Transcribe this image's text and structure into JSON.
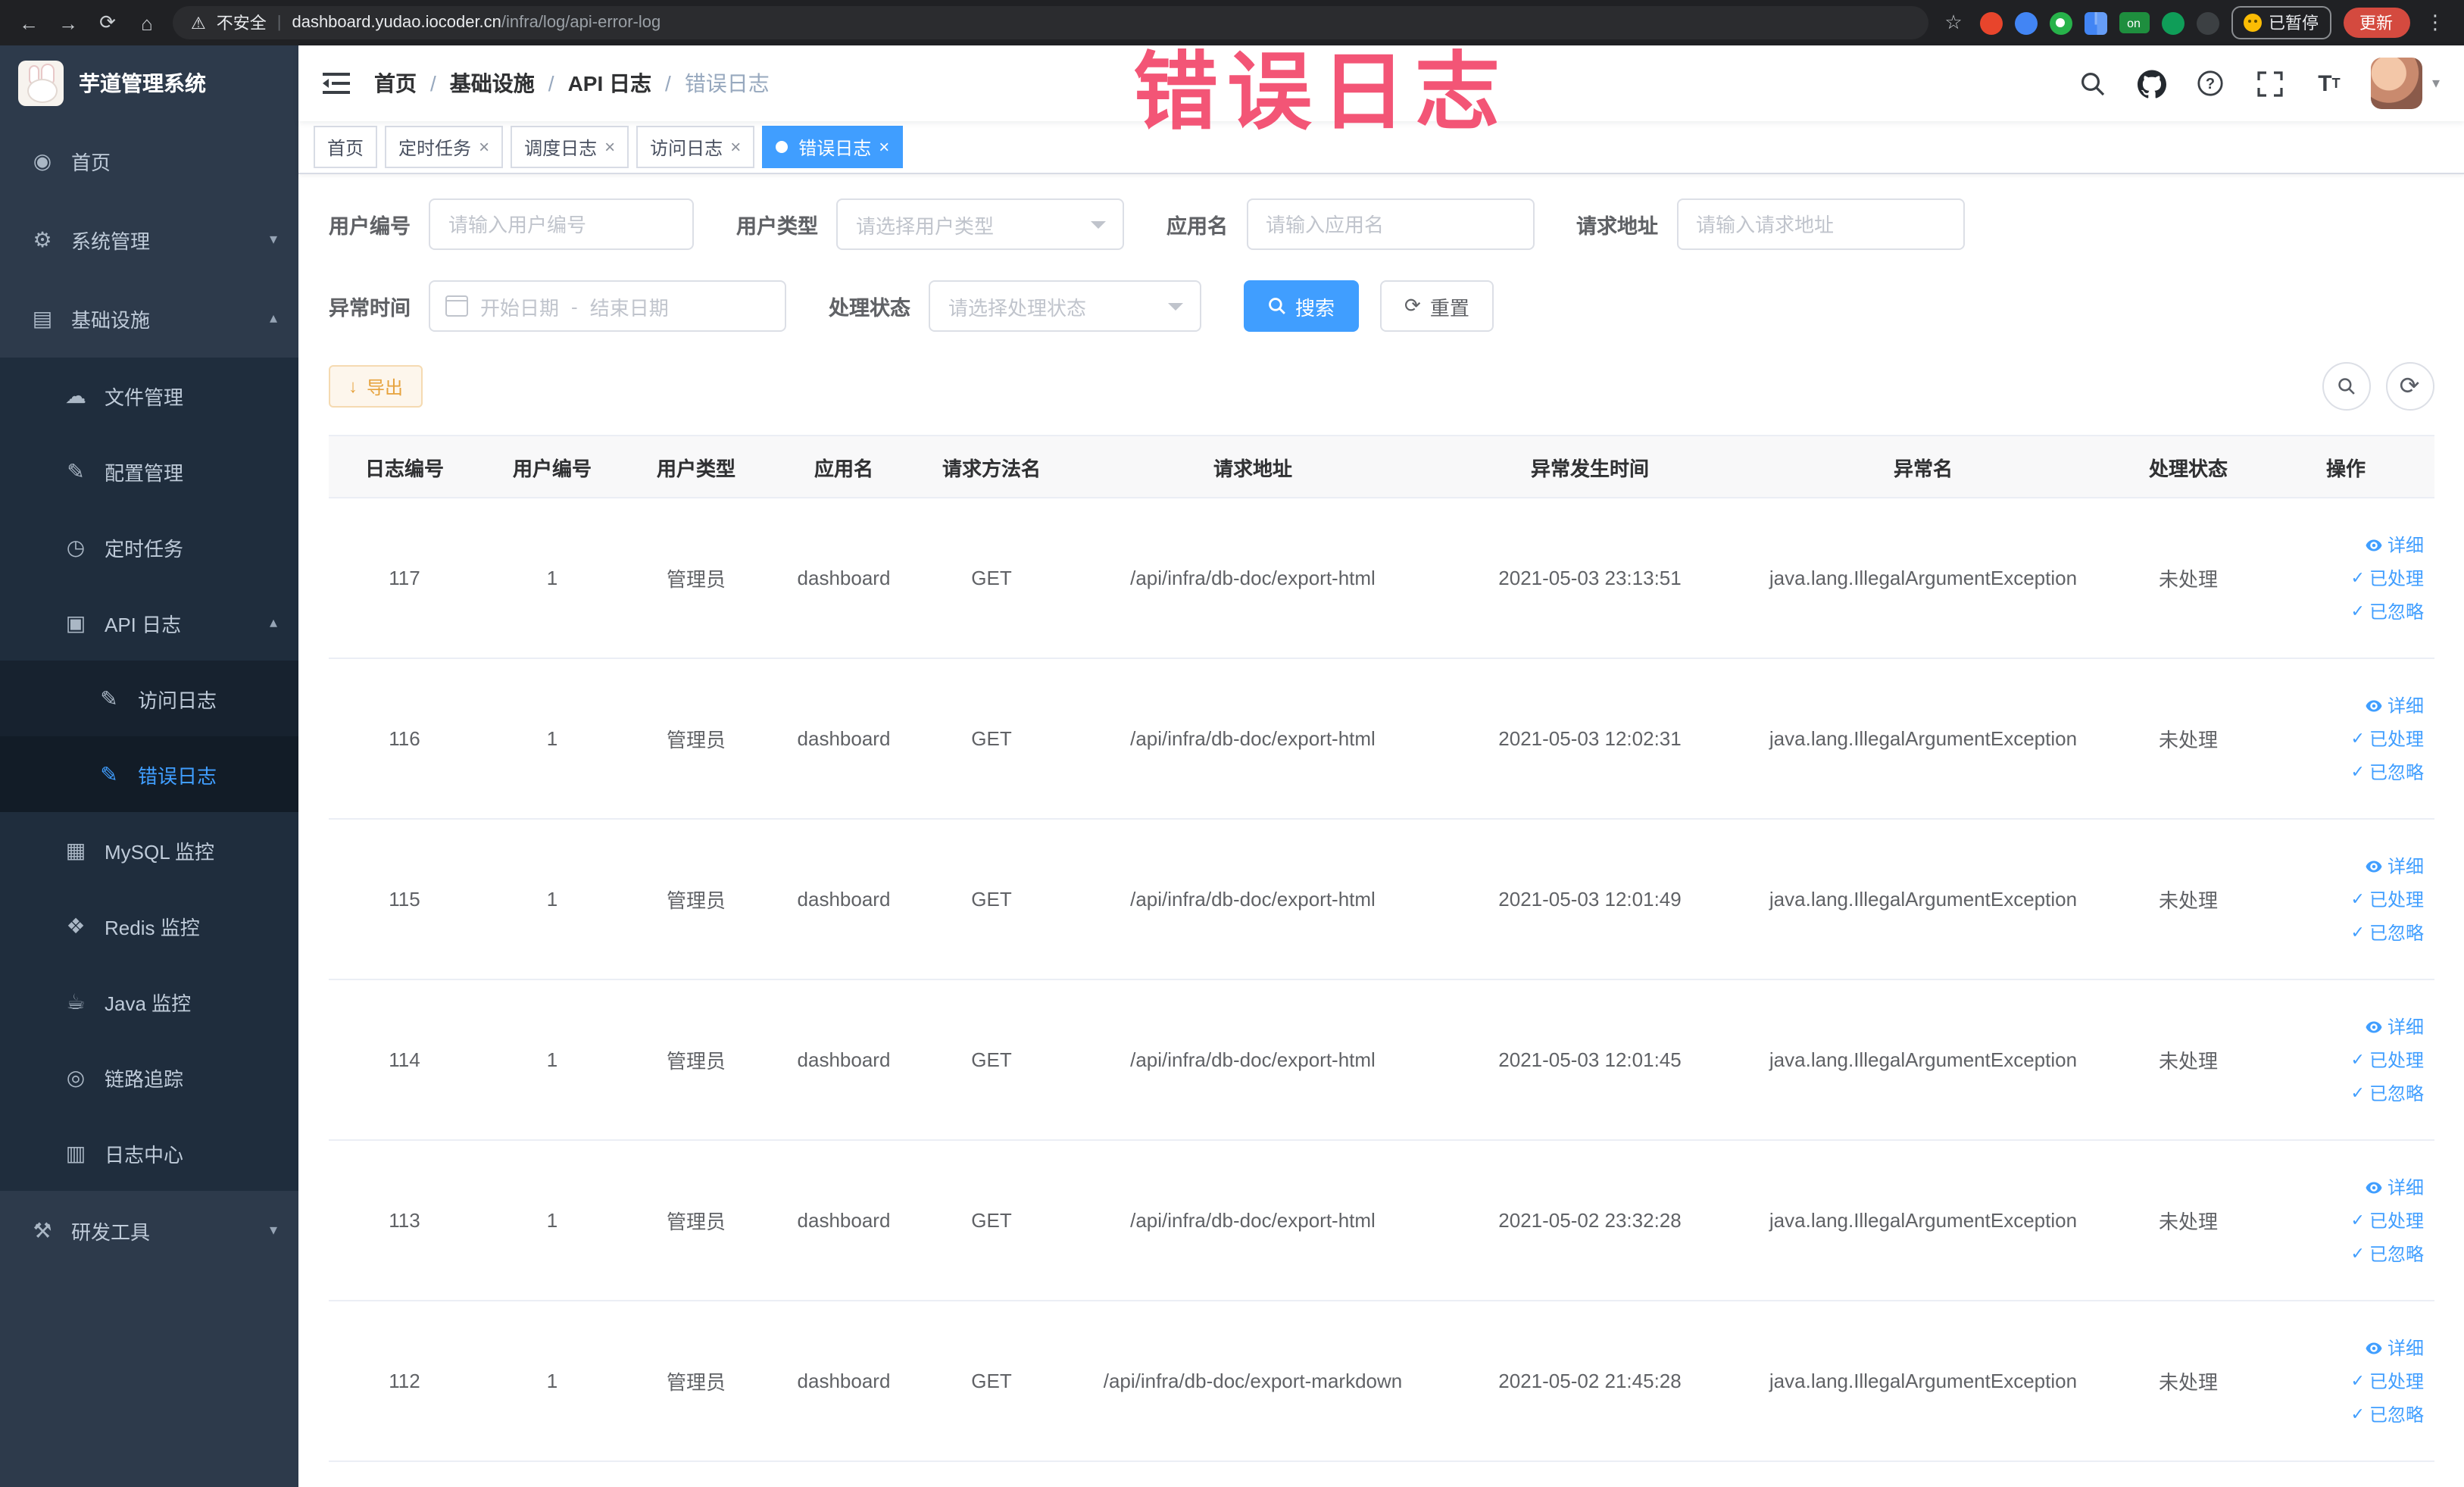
{
  "annotation": {
    "text": "错误日志"
  },
  "icons": {
    "back": "←",
    "forward": "→",
    "reload": "⟳",
    "home": "⌂",
    "star": "☆",
    "menu": "⋮",
    "warning": "⚠",
    "separator": "/",
    "caret_down": "▾",
    "caret_up": "▴",
    "check": "✓",
    "close": "×",
    "download": "↓",
    "refresh": "⟳"
  },
  "browser": {
    "security_label": "不安全",
    "url_domain": "dashboard.yudao.iocoder.cn",
    "url_path": "/infra/log/api-error-log",
    "extension_badge": "on",
    "paused_label": "已暂停",
    "update_label": "更新"
  },
  "sidebar": {
    "logo_title": "芋道管理系统",
    "items": [
      {
        "label": "首页",
        "glyph": "◉"
      },
      {
        "label": "系统管理",
        "glyph": "⚙"
      },
      {
        "label": "基础设施",
        "glyph": "▤"
      },
      {
        "label": "文件管理",
        "glyph": "☁"
      },
      {
        "label": "配置管理",
        "glyph": "✎"
      },
      {
        "label": "定时任务",
        "glyph": "◷"
      },
      {
        "label": "API 日志",
        "glyph": "▣"
      },
      {
        "label": "访问日志",
        "glyph": "✎"
      },
      {
        "label": "错误日志",
        "glyph": "✎"
      },
      {
        "label": "MySQL 监控",
        "glyph": "▦"
      },
      {
        "label": "Redis 监控",
        "glyph": "❖"
      },
      {
        "label": "Java 监控",
        "glyph": "☕"
      },
      {
        "label": "链路追踪",
        "glyph": "◎"
      },
      {
        "label": "日志中心",
        "glyph": "▥"
      },
      {
        "label": "研发工具",
        "glyph": "⚒"
      }
    ]
  },
  "navbar": {
    "breadcrumbs": [
      "首页",
      "基础设施",
      "API 日志",
      "错误日志"
    ]
  },
  "tabs": [
    {
      "label": "首页"
    },
    {
      "label": "定时任务"
    },
    {
      "label": "调度日志"
    },
    {
      "label": "访问日志"
    },
    {
      "label": "错误日志"
    }
  ],
  "filters": {
    "user_id": {
      "label": "用户编号",
      "placeholder": "请输入用户编号"
    },
    "user_type": {
      "label": "用户类型",
      "placeholder": "请选择用户类型"
    },
    "app_name": {
      "label": "应用名",
      "placeholder": "请输入应用名"
    },
    "request_url": {
      "label": "请求地址",
      "placeholder": "请输入请求地址"
    },
    "exception_time": {
      "label": "异常时间",
      "start_placeholder": "开始日期",
      "separator": "-",
      "end_placeholder": "结束日期"
    },
    "process_status": {
      "label": "处理状态",
      "placeholder": "请选择处理状态"
    },
    "search_label": "搜索",
    "reset_label": "重置"
  },
  "toolbar": {
    "export_label": "导出"
  },
  "table": {
    "headers": [
      "日志编号",
      "用户编号",
      "用户类型",
      "应用名",
      "请求方法名",
      "请求地址",
      "异常发生时间",
      "异常名",
      "处理状态",
      "操作"
    ],
    "actions": [
      "详细",
      "已处理",
      "已忽略"
    ],
    "rows": [
      {
        "id": "117",
        "user_id": "1",
        "user_type": "管理员",
        "app": "dashboard",
        "method": "GET",
        "url": "/api/infra/db-doc/export-html",
        "time": "2021-05-03 23:13:51",
        "exception": "java.lang.IllegalArgumentException",
        "status": "未处理"
      },
      {
        "id": "116",
        "user_id": "1",
        "user_type": "管理员",
        "app": "dashboard",
        "method": "GET",
        "url": "/api/infra/db-doc/export-html",
        "time": "2021-05-03 12:02:31",
        "exception": "java.lang.IllegalArgumentException",
        "status": "未处理"
      },
      {
        "id": "115",
        "user_id": "1",
        "user_type": "管理员",
        "app": "dashboard",
        "method": "GET",
        "url": "/api/infra/db-doc/export-html",
        "time": "2021-05-03 12:01:49",
        "exception": "java.lang.IllegalArgumentException",
        "status": "未处理"
      },
      {
        "id": "114",
        "user_id": "1",
        "user_type": "管理员",
        "app": "dashboard",
        "method": "GET",
        "url": "/api/infra/db-doc/export-html",
        "time": "2021-05-03 12:01:45",
        "exception": "java.lang.IllegalArgumentException",
        "status": "未处理"
      },
      {
        "id": "113",
        "user_id": "1",
        "user_type": "管理员",
        "app": "dashboard",
        "method": "GET",
        "url": "/api/infra/db-doc/export-html",
        "time": "2021-05-02 23:32:28",
        "exception": "java.lang.IllegalArgumentException",
        "status": "未处理"
      },
      {
        "id": "112",
        "user_id": "1",
        "user_type": "管理员",
        "app": "dashboard",
        "method": "GET",
        "url": "/api/infra/db-doc/export-markdown",
        "time": "2021-05-02 21:45:28",
        "exception": "java.lang.IllegalArgumentException",
        "status": "未处理"
      }
    ]
  }
}
